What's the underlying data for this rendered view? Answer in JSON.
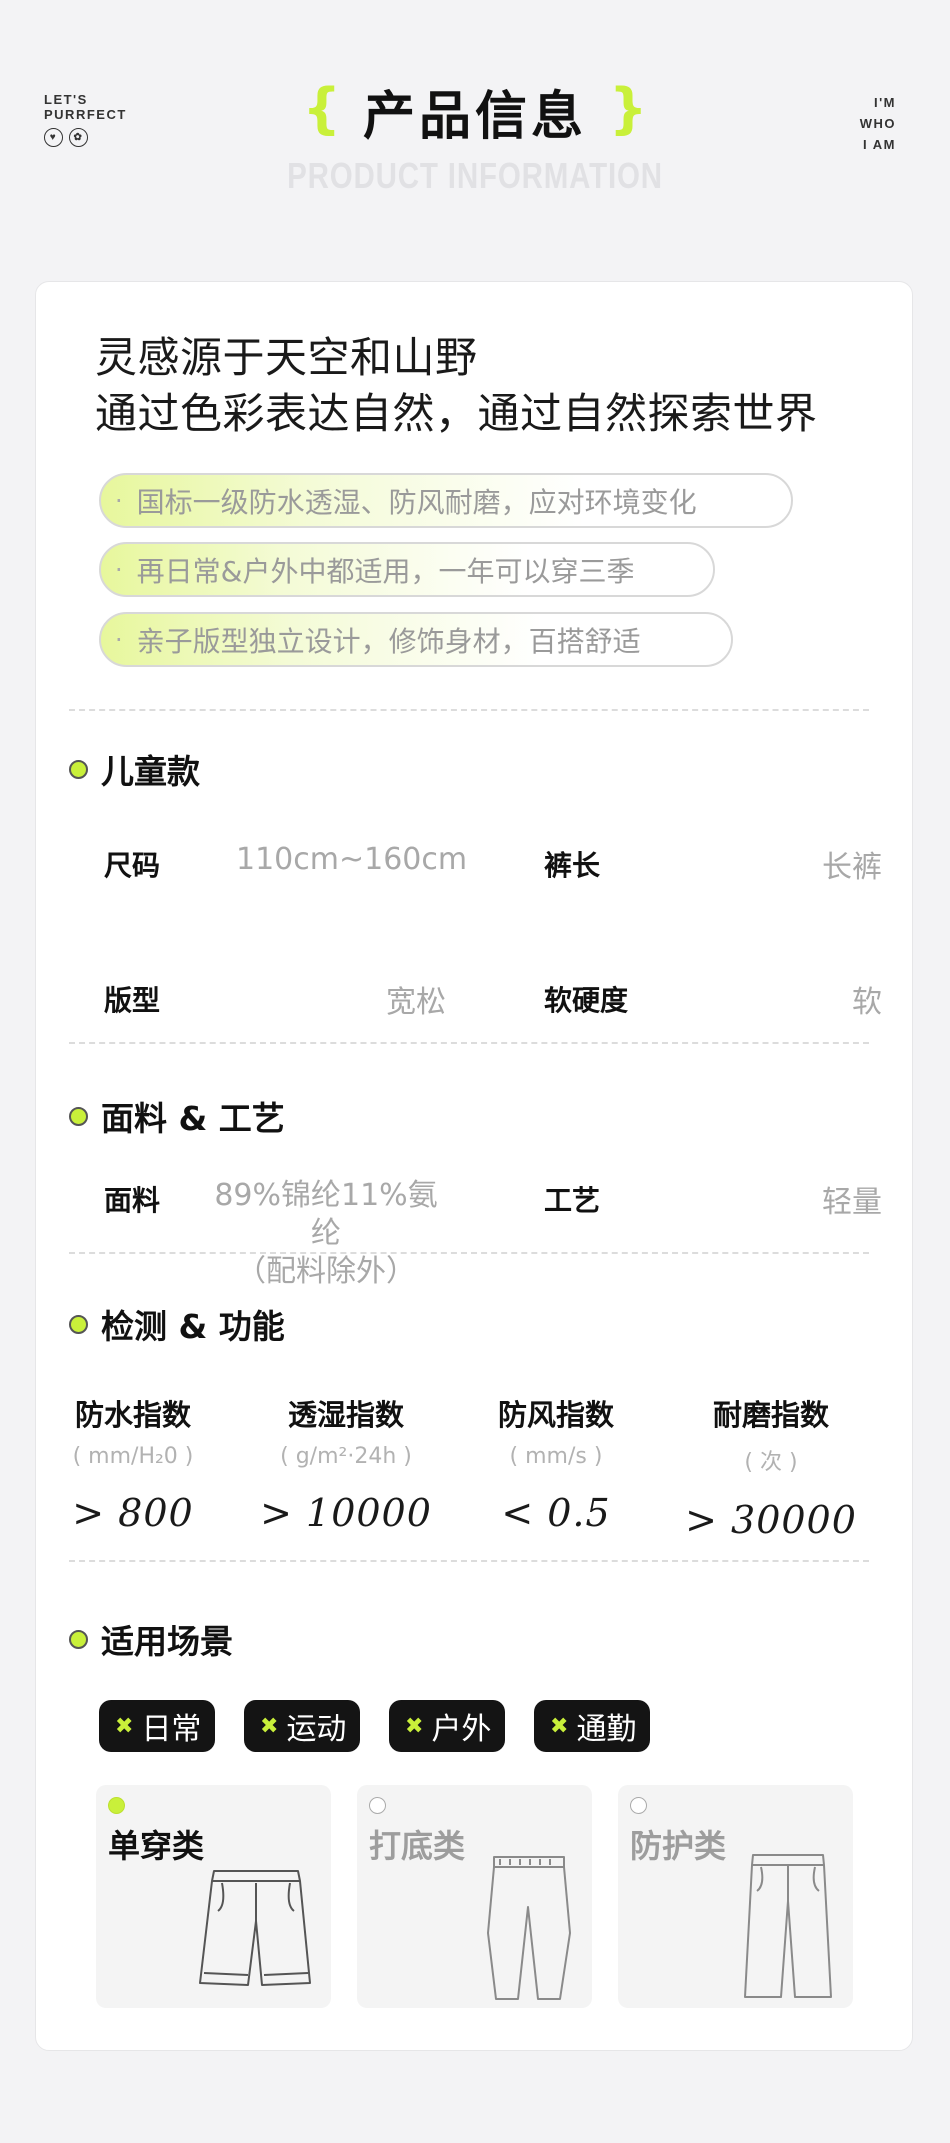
{
  "brand": {
    "left_line1": "LET'S",
    "left_line2": "PURRFECT",
    "right_line1": "I'M",
    "right_line2": "WHO",
    "right_line3": "I AM"
  },
  "header": {
    "title": "产品信息",
    "subtitle": "PRODUCT INFORMATION",
    "bracket_left": "{",
    "bracket_right": "}"
  },
  "intro": {
    "line1": "灵感源于天空和山野",
    "line2": "通过色彩表达自然，通过自然探索世界",
    "features": [
      "国标一级防水透湿、防风耐磨，应对环境变化",
      "再日常&户外中都适用，一年可以穿三季",
      "亲子版型独立设计，修饰身材，百搭舒适"
    ]
  },
  "kids": {
    "title": "儿童款",
    "size_label": "尺码",
    "size_value": "110cm~160cm",
    "length_label": "裤长",
    "length_value": "长裤",
    "fit_label": "版型",
    "fit_value": "宽松",
    "softness_label": "软硬度",
    "softness_value": "软"
  },
  "fabric": {
    "title": "面料 & 工艺",
    "fabric_label": "面料",
    "fabric_value_line1": "89%锦纶11%氨纶",
    "fabric_value_line2": "（配料除外）",
    "craft_label": "工艺",
    "craft_value": "轻量"
  },
  "tests": {
    "title": "检测 & 功能",
    "metrics": [
      {
        "name": "防水指数",
        "unit": "( mm/H₂0 )",
        "value": "> 800"
      },
      {
        "name": "透湿指数",
        "unit": "( g/m²·24h )",
        "value": "> 10000"
      },
      {
        "name": "防风指数",
        "unit": "( mm/s )",
        "value": "< 0.5"
      },
      {
        "name": "耐磨指数",
        "unit": "( 次 )",
        "value": "> 30000"
      }
    ]
  },
  "scenes": {
    "title": "适用场景",
    "tags": [
      "日常",
      "运动",
      "户外",
      "通勤"
    ],
    "cards": [
      {
        "label": "单穿类",
        "selected": true
      },
      {
        "label": "打底类",
        "selected": false
      },
      {
        "label": "防护类",
        "selected": false
      }
    ]
  },
  "colors": {
    "accent": "#c9f03a",
    "tag_bg": "#141414",
    "muted_text": "#a8a8a8"
  }
}
